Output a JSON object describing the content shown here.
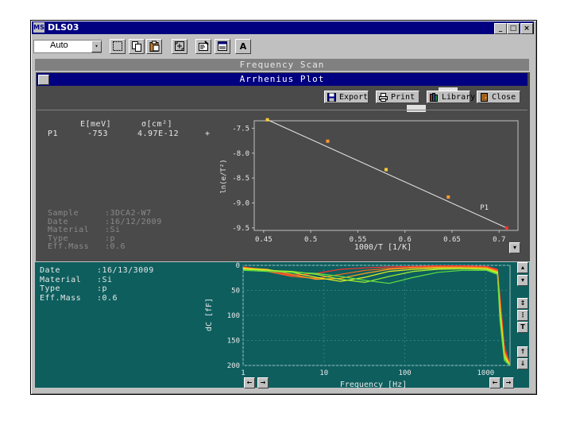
{
  "window": {
    "title": "DLS03",
    "app_icon_label": "MS",
    "min": "_",
    "max": "□",
    "close": "×"
  },
  "toolbar": {
    "combo_value": "Auto",
    "combo_arrow": "▾",
    "text_tool": "A"
  },
  "freq_scan": {
    "title": "Frequency Scan"
  },
  "arrhenius": {
    "title": "Arrhenius Plot",
    "buttons": {
      "export": "Export",
      "print": "Print",
      "library": "Library",
      "close": "Close"
    },
    "table": {
      "col_energy": "E[meV]",
      "col_sigma": "σ[cm²]",
      "row_label": "P1",
      "row_energy": "-753",
      "row_sigma": "4.97E-12",
      "row_mark": "+"
    },
    "sample_info": [
      {
        "key": "Sample",
        "value": ":3DCA2-W7"
      },
      {
        "key": "Date",
        "value": ":16/12/2009"
      },
      {
        "key": "Material",
        "value": ":Si"
      },
      {
        "key": "Type",
        "value": ":p"
      },
      {
        "key": "Eff.Mass",
        "value": ":0.6"
      }
    ]
  },
  "lower_info": [
    {
      "key": "Date",
      "value": ":16/13/3009"
    },
    {
      "key": "Material",
      "value": ":Si"
    },
    {
      "key": "Type",
      "value": ":p"
    },
    {
      "key": "Eff.Mass",
      "value": ":0.6"
    }
  ],
  "colors": {
    "arrhenius_bg": "#4a4a4a",
    "spectrum_bg": "#0e5e5e",
    "fit_line": "#e8e8e8",
    "point_marker": "#ffcc33",
    "title_bar": "#000080"
  },
  "chart_data": [
    {
      "type": "scatter",
      "title": "",
      "xlabel": "1000/T [1/K]",
      "ylabel": "ln(e/T²)",
      "xlim": [
        0.44,
        0.72
      ],
      "ylim": [
        -9.55,
        -7.35
      ],
      "xticks": [
        0.45,
        0.5,
        0.55,
        0.6,
        0.65,
        0.7
      ],
      "yticks": [
        -7.5,
        -8.0,
        -8.5,
        -9.0,
        -9.5
      ],
      "xtick_labels": [
        "0.45",
        "0.5",
        "0.55",
        "0.6",
        "0.65",
        "0.7"
      ],
      "ytick_labels": [
        "-7.5",
        "-8.0",
        "-8.5",
        "-9.0",
        "-9.5"
      ],
      "series": [
        {
          "name": "P1",
          "x": [
            0.454,
            0.518,
            0.58,
            0.646,
            0.708
          ],
          "y": [
            -7.33,
            -7.76,
            -8.33,
            -8.88,
            -9.5
          ]
        }
      ],
      "fit_line": {
        "x": [
          0.454,
          0.708
        ],
        "y": [
          -7.33,
          -9.5
        ]
      },
      "grid": false
    },
    {
      "type": "line",
      "title": "",
      "xlabel": "Frequency [Hz]",
      "ylabel": "dC [fF]",
      "xscale": "log",
      "xlim": [
        1,
        2000
      ],
      "ylim": [
        0,
        200
      ],
      "y_inverted": true,
      "xticks": [
        1,
        10,
        100,
        1000
      ],
      "yticks": [
        0,
        50,
        100,
        150,
        200
      ],
      "xtick_labels": [
        "1",
        "10",
        "100",
        "1000"
      ],
      "ytick_labels": [
        "0",
        "50",
        "100",
        "150",
        "200"
      ],
      "x": [
        1,
        2,
        4,
        8,
        16,
        32,
        64,
        128,
        256,
        512,
        1024,
        1400,
        1500,
        1700,
        2000
      ],
      "series": [
        {
          "color": "#ff3030",
          "values": [
            3,
            10,
            20,
            16,
            8,
            5,
            3,
            2,
            1,
            1,
            2,
            8,
            60,
            160,
            200
          ]
        },
        {
          "color": "#ff6a20",
          "values": [
            4,
            12,
            22,
            26,
            18,
            10,
            6,
            4,
            3,
            3,
            4,
            10,
            70,
            170,
            200
          ]
        },
        {
          "color": "#ff9f1a",
          "values": [
            5,
            8,
            18,
            28,
            26,
            16,
            8,
            5,
            4,
            4,
            5,
            12,
            80,
            175,
            200
          ]
        },
        {
          "color": "#e8f020",
          "values": [
            6,
            9,
            14,
            24,
            32,
            24,
            12,
            8,
            6,
            6,
            7,
            14,
            90,
            180,
            200
          ]
        },
        {
          "color": "#a8f030",
          "values": [
            8,
            10,
            12,
            18,
            28,
            34,
            22,
            12,
            8,
            7,
            8,
            16,
            100,
            185,
            200
          ]
        },
        {
          "color": "#60e040",
          "values": [
            10,
            12,
            14,
            16,
            22,
            30,
            36,
            24,
            14,
            10,
            10,
            18,
            110,
            190,
            200
          ]
        }
      ],
      "grid": true
    }
  ]
}
